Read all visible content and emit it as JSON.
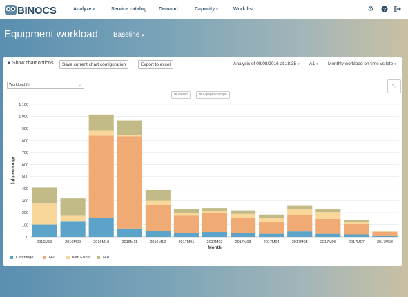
{
  "app": {
    "logo_text": "BINOCS"
  },
  "nav": [
    {
      "label": "Analyze",
      "caret": "▾"
    },
    {
      "label": "Service catalog",
      "caret": ""
    },
    {
      "label": "Demand",
      "caret": ""
    },
    {
      "label": "Capacity",
      "caret": "▾"
    },
    {
      "label": "Work list",
      "caret": ""
    }
  ],
  "header": {
    "title": "Equipment workload",
    "scenario": "Baseline",
    "scenario_caret": "▾"
  },
  "options": {
    "show_options": "Show chart options",
    "save_config": "Save current chart configuration",
    "export": "Export to excel",
    "analysis": "Analysis of 08/08/2016 at 18:35",
    "resource": "A1",
    "view": "Monthly workload on time vs late",
    "caret": "▾"
  },
  "measure_select": {
    "value": "Workload (h)",
    "caret": "⌄"
  },
  "chips": [
    "Month",
    "Equipment type"
  ],
  "colors": {
    "Centrifuge": "#5ba3c9",
    "HPLC": "#f0aa74",
    "Karl Fisher": "#f9d79a",
    "NIR": "#c2bb88"
  },
  "chart_data": {
    "type": "bar",
    "stacked": true,
    "categories": [
      "2016M08",
      "2016M09",
      "2016M10",
      "2016M11",
      "2016M12",
      "2017M01",
      "2017M02",
      "2017M03",
      "2017M04",
      "2017M05",
      "2017M06",
      "2017M07",
      "2017M08"
    ],
    "series": [
      {
        "name": "Centrifuge",
        "values": [
          100,
          130,
          160,
          70,
          50,
          30,
          40,
          30,
          25,
          45,
          25,
          20,
          10
        ]
      },
      {
        "name": "HPLC",
        "values": [
          0,
          0,
          680,
          765,
          215,
          145,
          155,
          130,
          95,
          135,
          125,
          85,
          30
        ]
      },
      {
        "name": "Karl Fisher",
        "values": [
          180,
          45,
          45,
          10,
          35,
          25,
          20,
          30,
          40,
          50,
          55,
          20,
          5
        ]
      },
      {
        "name": "NIR",
        "values": [
          130,
          145,
          130,
          120,
          90,
          30,
          25,
          30,
          25,
          30,
          30,
          15,
          5
        ]
      }
    ],
    "ylabel": "Workload (h)",
    "xlabel": "Month",
    "ylim": [
      0,
      1100
    ],
    "yticks": [
      "0",
      "100",
      "200",
      "300",
      "400",
      "500",
      "600",
      "700",
      "800",
      "900",
      "1 000",
      "1 100"
    ],
    "grid": true,
    "legend_position": "bottom-left"
  }
}
